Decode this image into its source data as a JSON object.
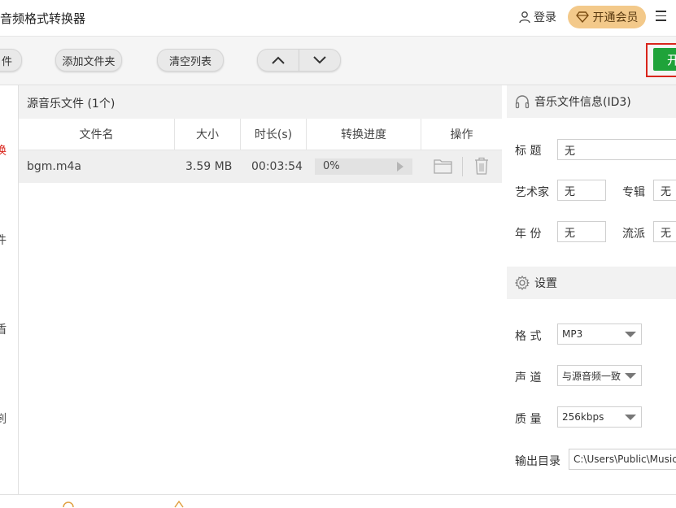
{
  "titlebar": {
    "title": "音频格式转换器",
    "login_label": "登录",
    "vip_label": "开通会员",
    "menu_glyph": "☰"
  },
  "toolbar": {
    "add_file_label": "件",
    "add_folder_label": "添加文件夹",
    "clear_list_label": "清空列表",
    "start_label": "开"
  },
  "sidebar": {
    "items": [
      {
        "label": "换",
        "color": "#d9251c"
      },
      {
        "label": "件"
      },
      {
        "label": "盾"
      },
      {
        "label": "剀"
      }
    ]
  },
  "file_panel": {
    "title": "源音乐文件 (1个)",
    "columns": [
      "文件名",
      "大小",
      "时长(s)",
      "转换进度",
      "操作"
    ],
    "rows": [
      {
        "name": "bgm.m4a",
        "size": "3.59 MB",
        "duration": "00:03:54",
        "progress": "0%"
      }
    ]
  },
  "id3": {
    "header": "音乐文件信息(ID3)",
    "title_label": "标  题",
    "title_value": "无",
    "artist_label": "艺术家",
    "artist_value": "无",
    "album_label": "专辑",
    "album_value": "无",
    "year_label": "年  份",
    "year_value": "无",
    "genre_label": "流派",
    "genre_value": "无"
  },
  "settings": {
    "header": "设置",
    "format_label": "格  式",
    "format_value": "MP3",
    "channel_label": "声  道",
    "channel_value": "与源音频一致",
    "quality_label": "质  量",
    "quality_value": "256kbps",
    "output_label": "输出目录",
    "output_value": "C:\\Users\\Public\\Music"
  },
  "colors": {
    "accent_green": "#1fa33a",
    "vip_gold": "#f3c98a",
    "highlight_red": "#d9251c"
  }
}
